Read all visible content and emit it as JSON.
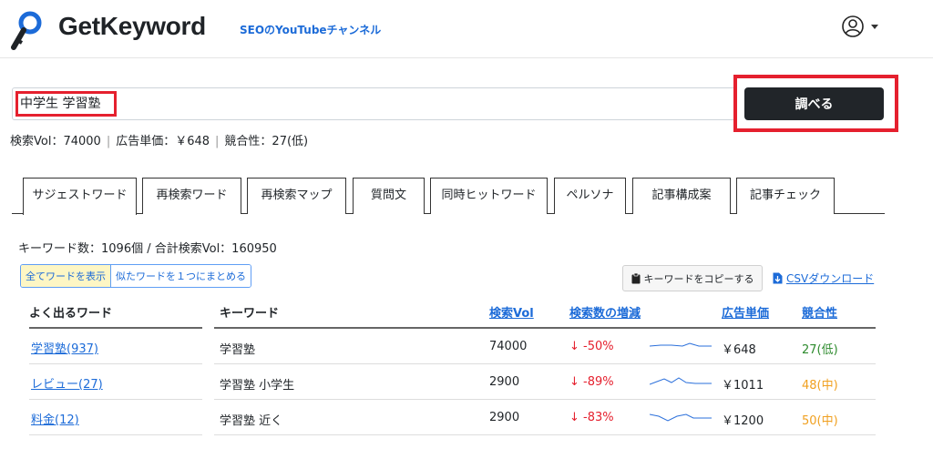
{
  "header": {
    "brand": "GetKeyword",
    "youtube_link": "SEOのYouTubeチャンネル"
  },
  "search": {
    "query": "中学生 学習塾",
    "button_label": "調べる"
  },
  "stats": {
    "volume": "検索Vol：74000",
    "cpc": "広告単価：￥648",
    "competition": "競合性：27(低)"
  },
  "tabs": [
    {
      "label": "サジェストワード",
      "active": true
    },
    {
      "label": "再検索ワード"
    },
    {
      "label": "再検索マップ"
    },
    {
      "label": "質問文"
    },
    {
      "label": "同時ヒットワード"
    },
    {
      "label": "ペルソナ"
    },
    {
      "label": "記事構成案"
    },
    {
      "label": "記事チェック"
    }
  ],
  "summary": "キーワード数：1096個 / 合計検索Vol：160950",
  "toggles": {
    "show_all": "全てワードを表示",
    "group_similar": "似たワードを１つにまとめる"
  },
  "actions": {
    "copy_keywords": "キーワードをコピーする",
    "csv_download": "CSVダウンロード"
  },
  "frequent_words": {
    "header": "よく出るワード",
    "items": [
      "学習塾(937)",
      "レビュー(27)",
      "料金(12)"
    ]
  },
  "table": {
    "columns": {
      "keyword": "キーワード",
      "volume": "検索Vol",
      "trend": "検索数の増減",
      "cpc": "広告単価",
      "competition": "競合性"
    },
    "rows": [
      {
        "keyword": "学習塾",
        "volume": "74000",
        "trend": "↓ -50%",
        "cpc": "￥648",
        "competition": "27(低)"
      },
      {
        "keyword": "学習塾 小学生",
        "volume": "2900",
        "trend": "↓ -89%",
        "cpc": "￥1011",
        "competition": "48(中)"
      },
      {
        "keyword": "学習塾 近く",
        "volume": "2900",
        "trend": "↓ -83%",
        "cpc": "￥1200",
        "competition": "50(中)"
      }
    ]
  },
  "colors": {
    "accent_blue": "#1c6bd8",
    "highlight_red": "#e5202e",
    "low_green": "#2e8b2e",
    "mid_orange": "#f0a020",
    "spark_blue": "#2a6fdb"
  },
  "icons": {
    "logo": "magnifier-key-icon",
    "user": "user-circle-icon",
    "clipboard": "clipboard-icon",
    "download": "download-icon"
  }
}
